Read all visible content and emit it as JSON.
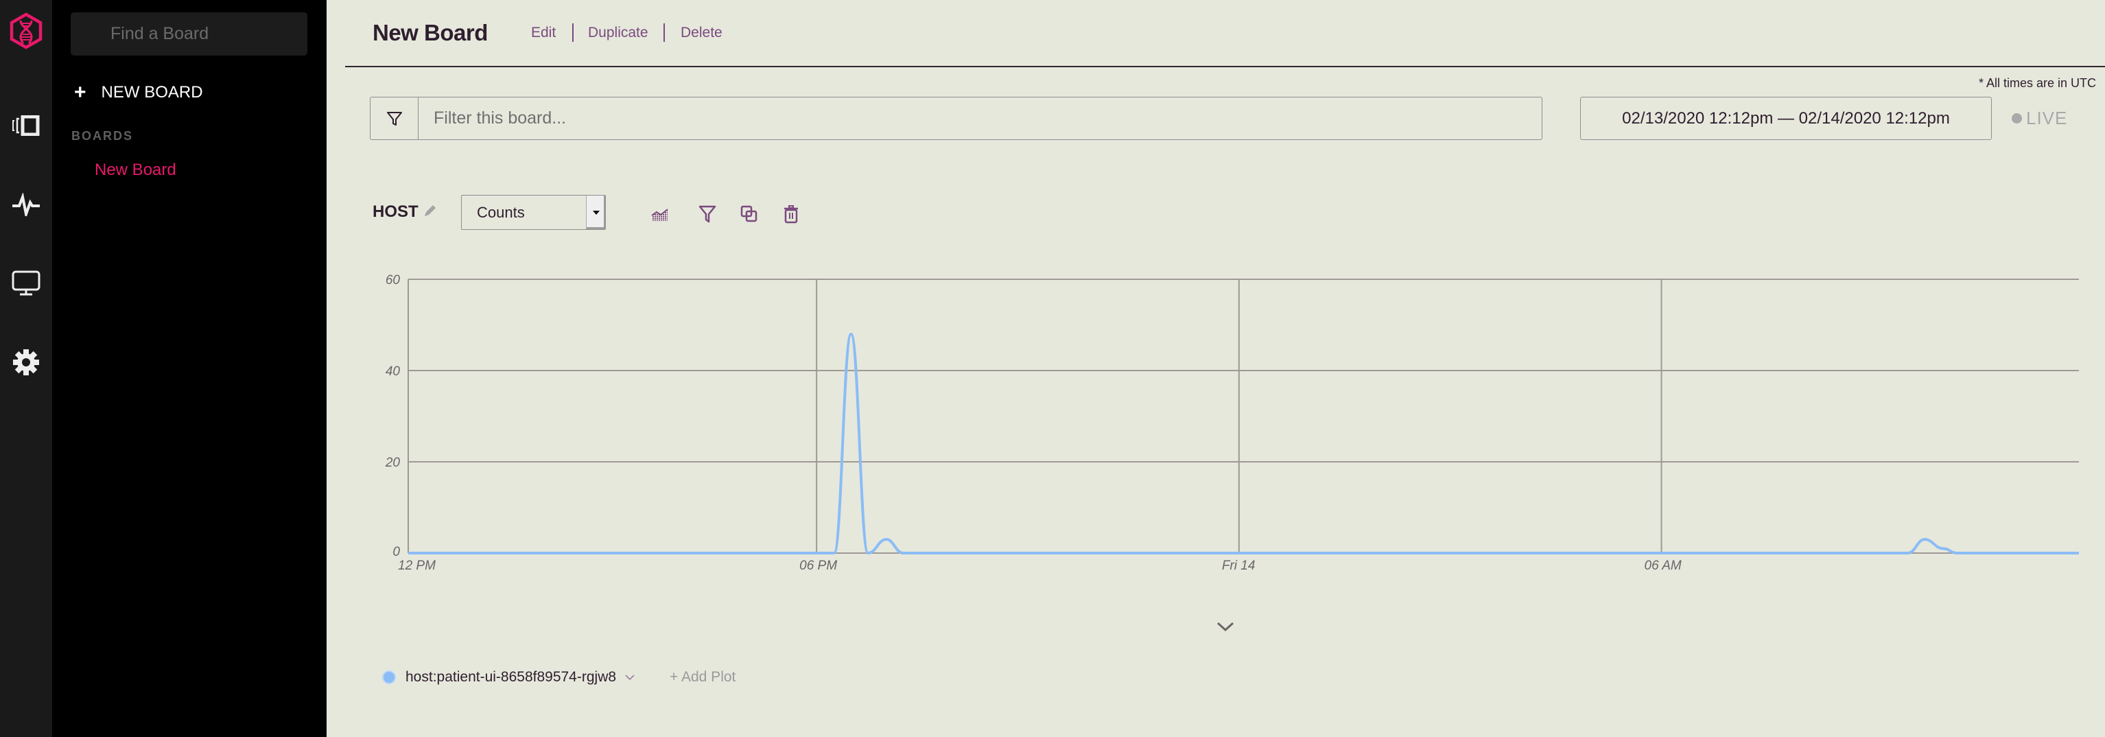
{
  "rail": {
    "items": [
      {
        "name": "logo",
        "icon": "dna-hexagon-logo-icon"
      },
      {
        "name": "boards",
        "icon": "boards-icon"
      },
      {
        "name": "monitoring",
        "icon": "pulse-icon"
      },
      {
        "name": "display",
        "icon": "monitor-icon"
      },
      {
        "name": "settings",
        "icon": "gear-icon"
      }
    ]
  },
  "sidebar": {
    "search_placeholder": "Find a Board",
    "new_board_label": "NEW BOARD",
    "boards_heading": "BOARDS",
    "boards": [
      {
        "label": "New Board",
        "active": true
      }
    ]
  },
  "header": {
    "title": "New Board",
    "actions": [
      "Edit",
      "Duplicate",
      "Delete"
    ]
  },
  "filter": {
    "placeholder": "Filter this board...",
    "value": ""
  },
  "time": {
    "note": "* All times are in UTC",
    "range": "02/13/2020 12:12pm — 02/14/2020 12:12pm",
    "live_label": "LIVE",
    "live_active": false
  },
  "panel": {
    "title": "HOST",
    "metric": "Counts",
    "tools": [
      "area-chart-icon",
      "filter-icon",
      "duplicate-icon",
      "trash-icon"
    ]
  },
  "colors": {
    "accent": "#e8186a",
    "link": "#7a4a7f",
    "series": "#8bbcf5",
    "grid": "#9e9995",
    "background": "#e6e8dc"
  },
  "chart_data": {
    "type": "line",
    "title": "HOST",
    "xlabel": "",
    "ylabel": "Counts",
    "ylim": [
      0,
      60
    ],
    "yticks": [
      0,
      20,
      40,
      60
    ],
    "xlim_hours": [
      0.2,
      23.93
    ],
    "xticks": [
      {
        "label": "12 PM",
        "hour": 0
      },
      {
        "label": "06 PM",
        "hour": 6
      },
      {
        "label": "Fri 14",
        "hour": 12
      },
      {
        "label": "06 AM",
        "hour": 18
      }
    ],
    "grid": true,
    "legend": "bottom-left",
    "series": [
      {
        "name": "host:patient-ui-8658f89574-rgjw8",
        "points": [
          {
            "hour": 0.2,
            "value": 0
          },
          {
            "hour": 6.25,
            "value": 0
          },
          {
            "hour": 6.49,
            "value": 48
          },
          {
            "hour": 6.73,
            "value": 0
          },
          {
            "hour": 6.99,
            "value": 3
          },
          {
            "hour": 7.23,
            "value": 0
          },
          {
            "hour": 21.5,
            "value": 0
          },
          {
            "hour": 21.74,
            "value": 3
          },
          {
            "hour": 22.0,
            "value": 1
          },
          {
            "hour": 22.2,
            "value": 0
          },
          {
            "hour": 23.93,
            "value": 0
          }
        ]
      }
    ]
  },
  "legend": {
    "items": [
      {
        "label": "host:patient-ui-8658f89574-rgjw8"
      }
    ],
    "add_plot_label": "+ Add Plot"
  }
}
